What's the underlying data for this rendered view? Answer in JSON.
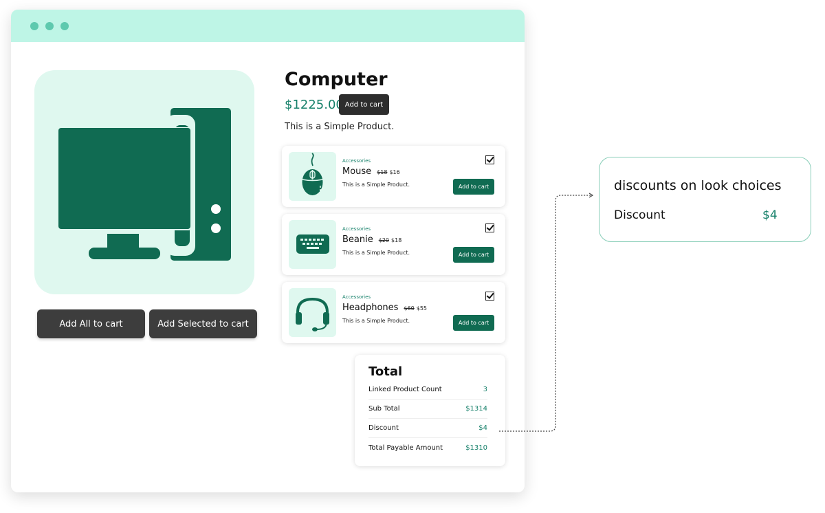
{
  "product": {
    "title": "Computer",
    "price": "$1225.00",
    "add_to_cart_label": "Add to cart",
    "description": "This is a Simple Product."
  },
  "actions": {
    "add_all_label": "Add All to cart",
    "add_selected_label": "Add Selected to cart"
  },
  "linked_products": [
    {
      "category": "Accessories",
      "name": "Mouse",
      "old_price": "$18",
      "new_price": "$16",
      "description": "This is a Simple Product.",
      "add_label": "Add to cart",
      "checked": true,
      "icon": "mouse-icon"
    },
    {
      "category": "Accessories",
      "name": "Beanie",
      "old_price": "$20",
      "new_price": "$18",
      "description": "This is a Simple Product.",
      "add_label": "Add to cart",
      "checked": true,
      "icon": "keyboard-icon"
    },
    {
      "category": "Accessories",
      "name": "Headphones",
      "old_price": "$60",
      "new_price": "$55",
      "description": "This is a Simple Product.",
      "add_label": "Add to cart",
      "checked": true,
      "icon": "headphones-icon"
    }
  ],
  "total": {
    "title": "Total",
    "rows": [
      {
        "label": "Linked Product Count",
        "value": "3"
      },
      {
        "label": "Sub Total",
        "value": "$1314"
      },
      {
        "label": "Discount",
        "value": "$4"
      },
      {
        "label": "Total Payable Amount",
        "value": "$1310"
      }
    ]
  },
  "callout": {
    "title": "discounts on look choices",
    "label": "Discount",
    "value": "$4"
  },
  "colors": {
    "accent": "#16806a",
    "dark_green": "#106b52",
    "mint": "#dff8ef",
    "titlebar": "#bef5e6"
  }
}
